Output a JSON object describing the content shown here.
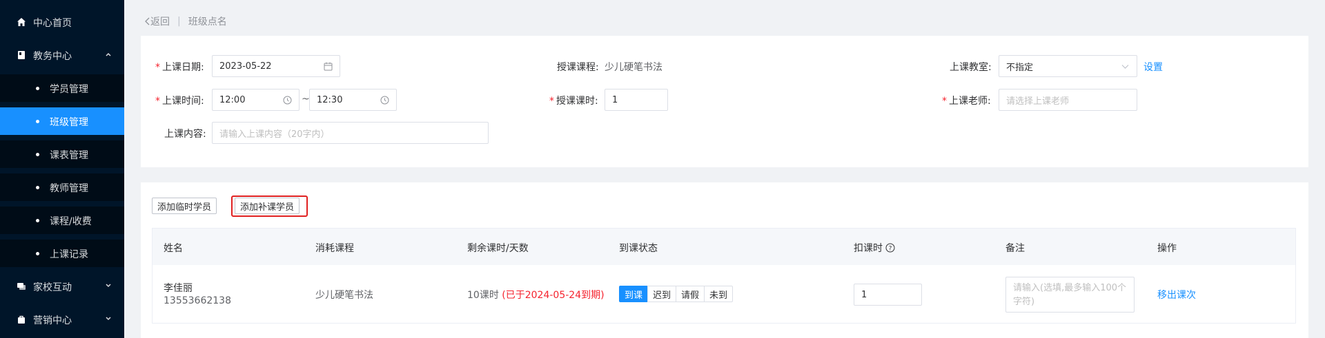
{
  "sidebar": {
    "items": [
      {
        "label": "中心首页",
        "icon": "home-icon"
      },
      {
        "label": "教务中心",
        "icon": "book-icon"
      },
      {
        "label": "家校互动",
        "icon": "chat-icon"
      },
      {
        "label": "营销中心",
        "icon": "bag-icon"
      }
    ],
    "sub_items": [
      "学员管理",
      "班级管理",
      "课表管理",
      "教师管理",
      "课程/收费",
      "上课记录"
    ],
    "active_sub": "班级管理"
  },
  "breadcrumb": {
    "back": "返回",
    "separator": "|",
    "current": "班级点名"
  },
  "form": {
    "date_label": "上课日期:",
    "date_value": "2023-05-22",
    "course_label": "授课课程:",
    "course_value": "少儿硬笔书法",
    "classroom_label": "上课教室:",
    "classroom_value": "不指定",
    "classroom_setting": "设置",
    "time_label": "上课时间:",
    "time_start": "12:00",
    "time_sep": "~",
    "time_end": "12:30",
    "hours_label": "授课课时:",
    "hours_value": "1",
    "teacher_label": "上课老师:",
    "teacher_placeholder": "请选择上课老师",
    "content_label": "上课内容:",
    "content_placeholder": "请输入上课内容（20字内）",
    "required_mark": "*"
  },
  "actions": {
    "add_temp": "添加临时学员",
    "add_makeup": "添加补课学员"
  },
  "table": {
    "headers": [
      "姓名",
      "消耗课程",
      "剩余课时/天数",
      "到课状态",
      "扣课时",
      "备注",
      "操作"
    ],
    "rows": [
      {
        "name": "李佳丽",
        "phone": "13553662138",
        "course": "少儿硬笔书法",
        "remaining": "10课时",
        "expiry": "(已于2024-05-24到期)",
        "status_options": [
          "到课",
          "迟到",
          "请假",
          "未到"
        ],
        "status_selected": "到课",
        "deduct": "1",
        "remark_placeholder": "请输入(选填,最多输入100个字符)",
        "action": "移出课次"
      }
    ]
  },
  "colors": {
    "sidebar_bg": "#001529",
    "accent": "#1890ff",
    "danger": "#f5222d",
    "highlight_border": "#e02020"
  }
}
